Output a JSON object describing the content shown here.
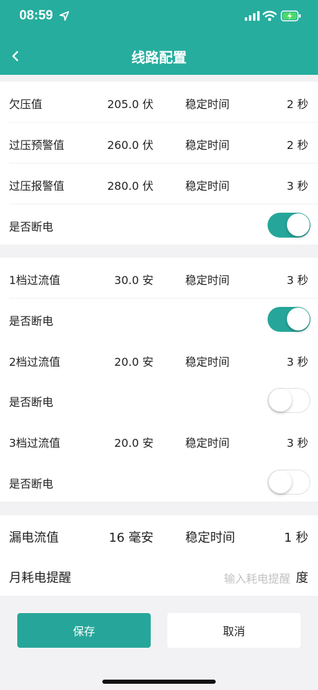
{
  "status_bar": {
    "time": "08:59"
  },
  "header": {
    "title": "线路配置",
    "back": "<"
  },
  "voltage": [
    {
      "label": "欠压值",
      "value": "205.0 伏",
      "stable_label": "稳定时间",
      "stable_value": "2 秒"
    },
    {
      "label": "过压预警值",
      "value": "260.0 伏",
      "stable_label": "稳定时间",
      "stable_value": "2 秒"
    },
    {
      "label": "过压报警值",
      "value": "280.0 伏",
      "stable_label": "稳定时间",
      "stable_value": "3 秒"
    }
  ],
  "voltage_cutoff": {
    "label": "是否断电",
    "on": true
  },
  "current": [
    {
      "label": "1档过流值",
      "value": "30.0 安",
      "stable_label": "稳定时间",
      "stable_value": "3 秒",
      "cutoff_label": "是否断电",
      "cutoff_on": true
    },
    {
      "label": "2档过流值",
      "value": "20.0 安",
      "stable_label": "稳定时间",
      "stable_value": "3 秒",
      "cutoff_label": "是否断电",
      "cutoff_on": false
    },
    {
      "label": "3档过流值",
      "value": "20.0 安",
      "stable_label": "稳定时间",
      "stable_value": "3 秒",
      "cutoff_label": "是否断电",
      "cutoff_on": false
    }
  ],
  "leakage": {
    "label": "漏电流值",
    "value": "16 毫安",
    "stable_label": "稳定时间",
    "stable_value": "1 秒"
  },
  "monthly": {
    "label": "月耗电提醒",
    "placeholder": "输入耗电提醒",
    "unit": "度"
  },
  "buttons": {
    "save": "保存",
    "cancel": "取消"
  },
  "colors": {
    "primary": "#26ad9e",
    "background": "#f2f2f4"
  }
}
